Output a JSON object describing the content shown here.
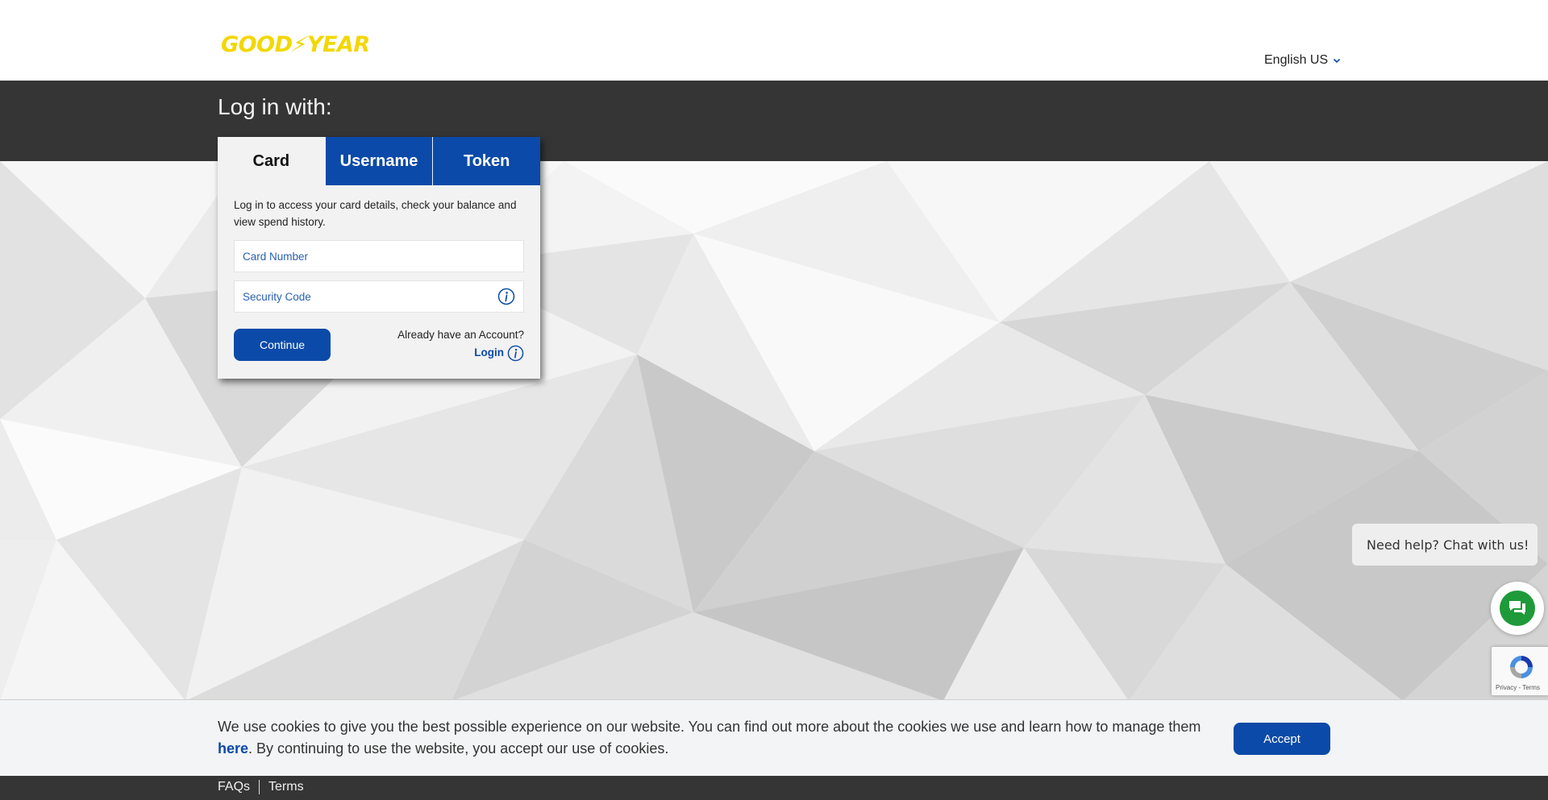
{
  "header": {
    "logo_text": "GOODYEAR",
    "logo_left": "GOOD",
    "logo_right": "YEAR",
    "language": "English US",
    "brand_color": "#f2d700"
  },
  "login": {
    "title": "Log in with:",
    "tabs": [
      {
        "label": "Card",
        "active": true
      },
      {
        "label": "Username",
        "active": false
      },
      {
        "label": "Token",
        "active": false
      }
    ],
    "description": "Log in to access your card details, check your balance and view spend history.",
    "card_number_placeholder": "Card Number",
    "security_code_placeholder": "Security Code",
    "continue_label": "Continue",
    "account_prompt": "Already have an Account?",
    "login_link": "Login",
    "accent_color": "#0b4aa8"
  },
  "chat": {
    "bubble_text": " Need help? Chat with us!",
    "button_color": "#1f9a3a"
  },
  "recaptcha": {
    "text": "Privacy - Terms"
  },
  "cookie": {
    "text_before": "We use cookies to give you the best possible experience on our website. You can find out more about the cookies we use and learn how to manage them ",
    "link": "here",
    "text_after": ". By continuing to use the website, you accept our use of cookies.",
    "accept_label": "Accept"
  },
  "footer": {
    "links": [
      "FAQs",
      "Terms"
    ]
  }
}
